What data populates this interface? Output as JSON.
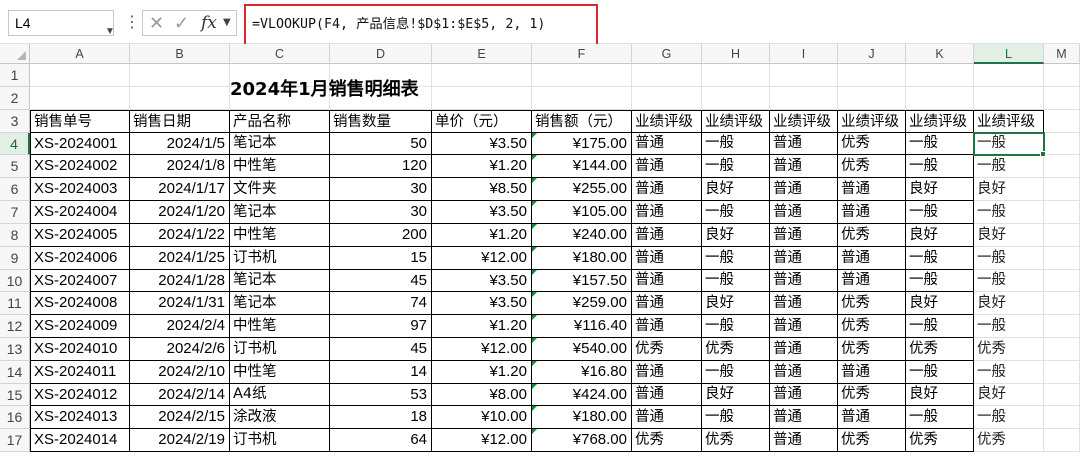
{
  "formula_bar": {
    "name_box": "L4",
    "menu_glyph": "⋮",
    "fx_label": "fx",
    "formula": "=VLOOKUP(F4, 产品信息!$D$1:$E$5, 2, 1)"
  },
  "columns": [
    "A",
    "B",
    "C",
    "D",
    "E",
    "F",
    "G",
    "H",
    "I",
    "J",
    "K",
    "L",
    "M"
  ],
  "row_numbers": [
    "1",
    "2",
    "3",
    "4",
    "5",
    "6",
    "7",
    "8",
    "9",
    "10",
    "11",
    "12",
    "13",
    "14",
    "15",
    "16",
    "17"
  ],
  "selected_cell": "L4",
  "sheet": {
    "title": "2024年1月销售明细表",
    "headers": [
      "销售单号",
      "销售日期",
      "产品名称",
      "销售数量",
      "单价（元）",
      "销售额（元）",
      "业绩评级",
      "业绩评级",
      "业绩评级",
      "业绩评级",
      "业绩评级",
      "业绩评级"
    ],
    "rows": [
      [
        "XS-2024001",
        "2024/1/5",
        "笔记本",
        "50",
        "¥3.50",
        "¥175.00",
        "普通",
        "一般",
        "普通",
        "优秀",
        "一般",
        "一般"
      ],
      [
        "XS-2024002",
        "2024/1/8",
        "中性笔",
        "120",
        "¥1.20",
        "¥144.00",
        "普通",
        "一般",
        "普通",
        "优秀",
        "一般",
        "一般"
      ],
      [
        "XS-2024003",
        "2024/1/17",
        "文件夹",
        "30",
        "¥8.50",
        "¥255.00",
        "普通",
        "良好",
        "普通",
        "普通",
        "良好",
        "良好"
      ],
      [
        "XS-2024004",
        "2024/1/20",
        "笔记本",
        "30",
        "¥3.50",
        "¥105.00",
        "普通",
        "一般",
        "普通",
        "普通",
        "一般",
        "一般"
      ],
      [
        "XS-2024005",
        "2024/1/22",
        "中性笔",
        "200",
        "¥1.20",
        "¥240.00",
        "普通",
        "良好",
        "普通",
        "优秀",
        "良好",
        "良好"
      ],
      [
        "XS-2024006",
        "2024/1/25",
        "订书机",
        "15",
        "¥12.00",
        "¥180.00",
        "普通",
        "一般",
        "普通",
        "普通",
        "一般",
        "一般"
      ],
      [
        "XS-2024007",
        "2024/1/28",
        "笔记本",
        "45",
        "¥3.50",
        "¥157.50",
        "普通",
        "一般",
        "普通",
        "普通",
        "一般",
        "一般"
      ],
      [
        "XS-2024008",
        "2024/1/31",
        "笔记本",
        "74",
        "¥3.50",
        "¥259.00",
        "普通",
        "良好",
        "普通",
        "优秀",
        "良好",
        "良好"
      ],
      [
        "XS-2024009",
        "2024/2/4",
        "中性笔",
        "97",
        "¥1.20",
        "¥116.40",
        "普通",
        "一般",
        "普通",
        "优秀",
        "一般",
        "一般"
      ],
      [
        "XS-2024010",
        "2024/2/6",
        "订书机",
        "45",
        "¥12.00",
        "¥540.00",
        "优秀",
        "优秀",
        "普通",
        "优秀",
        "优秀",
        "优秀"
      ],
      [
        "XS-2024011",
        "2024/2/10",
        "中性笔",
        "14",
        "¥1.20",
        "¥16.80",
        "普通",
        "一般",
        "普通",
        "普通",
        "一般",
        "一般"
      ],
      [
        "XS-2024012",
        "2024/2/14",
        "A4纸",
        "53",
        "¥8.00",
        "¥424.00",
        "普通",
        "良好",
        "普通",
        "优秀",
        "良好",
        "良好"
      ],
      [
        "XS-2024013",
        "2024/2/15",
        "涂改液",
        "18",
        "¥10.00",
        "¥180.00",
        "普通",
        "一般",
        "普通",
        "普通",
        "一般",
        "一般"
      ],
      [
        "XS-2024014",
        "2024/2/19",
        "订书机",
        "64",
        "¥12.00",
        "¥768.00",
        "优秀",
        "优秀",
        "普通",
        "优秀",
        "优秀",
        "优秀"
      ]
    ]
  }
}
